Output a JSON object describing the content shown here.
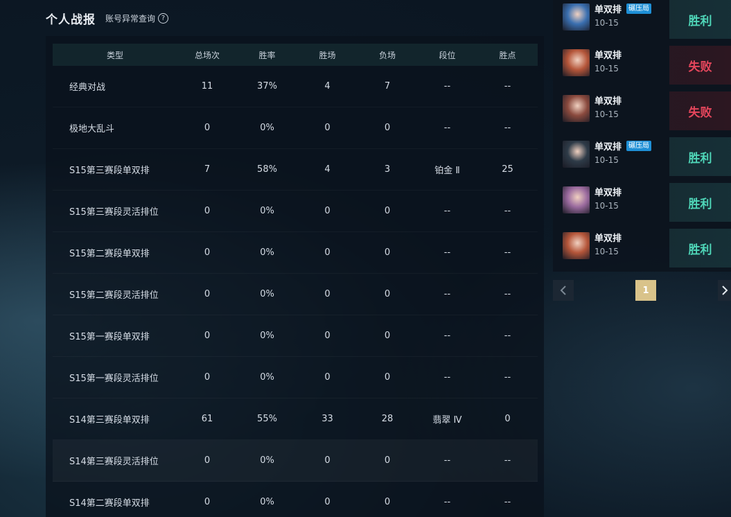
{
  "header": {
    "title": "个人战报",
    "account_link": "账号异常查询",
    "help_icon": "?"
  },
  "table": {
    "columns": [
      "类型",
      "总场次",
      "胜率",
      "胜场",
      "负场",
      "段位",
      "胜点"
    ],
    "rows": [
      [
        "经典对战",
        "11",
        "37%",
        "4",
        "7",
        "--",
        "--"
      ],
      [
        "极地大乱斗",
        "0",
        "0%",
        "0",
        "0",
        "--",
        "--"
      ],
      [
        "S15第三赛段单双排",
        "7",
        "58%",
        "4",
        "3",
        "铂金 Ⅱ",
        "25"
      ],
      [
        "S15第三赛段灵活排位",
        "0",
        "0%",
        "0",
        "0",
        "--",
        "--"
      ],
      [
        "S15第二赛段单双排",
        "0",
        "0%",
        "0",
        "0",
        "--",
        "--"
      ],
      [
        "S15第二赛段灵活排位",
        "0",
        "0%",
        "0",
        "0",
        "--",
        "--"
      ],
      [
        "S15第一赛段单双排",
        "0",
        "0%",
        "0",
        "0",
        "--",
        "--"
      ],
      [
        "S15第一赛段灵活排位",
        "0",
        "0%",
        "0",
        "0",
        "--",
        "--"
      ],
      [
        "S14第三赛段单双排",
        "61",
        "55%",
        "33",
        "28",
        "翡翠 Ⅳ",
        "0"
      ],
      [
        "S14第三赛段灵活排位",
        "0",
        "0%",
        "0",
        "0",
        "--",
        "--"
      ],
      [
        "S14第二赛段单双排",
        "0",
        "0%",
        "0",
        "0",
        "--",
        "--"
      ]
    ]
  },
  "matches": [
    {
      "mode": "单双排",
      "badge": "碾压局",
      "date": "10-15",
      "result": "胜利",
      "win": true,
      "avatar_color": "#3a6fb0"
    },
    {
      "mode": "单双排",
      "badge": "",
      "date": "10-15",
      "result": "失败",
      "win": false,
      "avatar_color": "#b5563a"
    },
    {
      "mode": "单双排",
      "badge": "",
      "date": "10-15",
      "result": "失败",
      "win": false,
      "avatar_color": "#8a4a3e"
    },
    {
      "mode": "单双排",
      "badge": "碾压局",
      "date": "10-15",
      "result": "胜利",
      "win": true,
      "avatar_color": "#2e3b48"
    },
    {
      "mode": "单双排",
      "badge": "",
      "date": "10-15",
      "result": "胜利",
      "win": true,
      "avatar_color": "#9a6a9e"
    },
    {
      "mode": "单双排",
      "badge": "",
      "date": "10-15",
      "result": "胜利",
      "win": true,
      "avatar_color": "#b5563a"
    }
  ],
  "pagination": {
    "current_page": "1",
    "prev_icon": "chevron-left-icon",
    "next_icon": "chevron-right-icon"
  },
  "colors": {
    "win": "#4fd6b8",
    "loss": "#e4465c",
    "badge": "#1e8fd6",
    "page_active": "#d9c38a"
  }
}
